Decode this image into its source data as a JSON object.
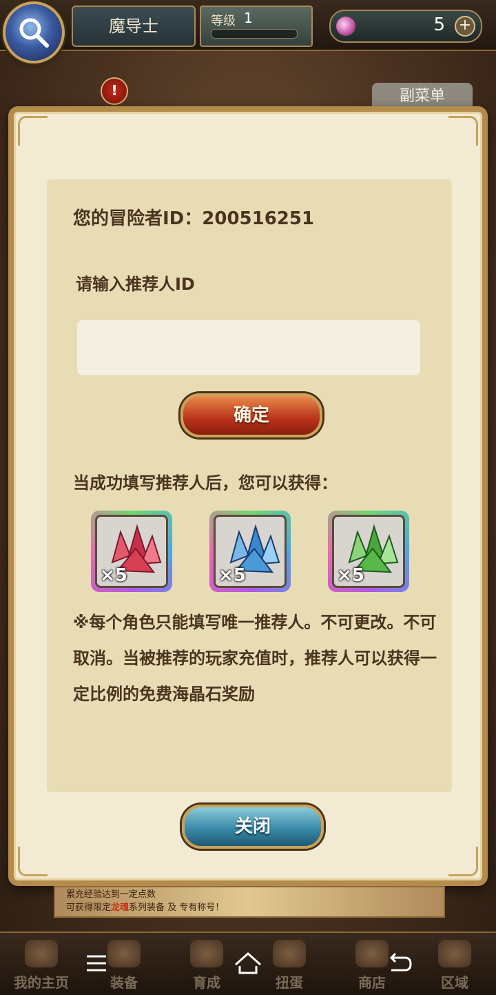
{
  "hud": {
    "player_name": "魔导士",
    "level_label": "等级",
    "level_value": "1",
    "gem_count": "5",
    "plus": "+",
    "alert": "!",
    "submenu_label": "副菜单"
  },
  "dialog": {
    "id_label": "您的冒险者ID：",
    "id_value": "200516251",
    "prompt": "请输入推荐人ID",
    "input_value": "",
    "input_placeholder": "",
    "confirm_label": "确定",
    "reward_title": "当成功填写推荐人后，您可以获得：",
    "rewards": [
      {
        "name": "red-crystal",
        "qty": "×5",
        "color": "#d83a4a"
      },
      {
        "name": "blue-crystal",
        "qty": "×5",
        "color": "#4a9ad8"
      },
      {
        "name": "green-crystal",
        "qty": "×5",
        "color": "#5ab84a"
      }
    ],
    "note": "※每个角色只能填写唯一推荐人。不可更改。不可取消。当被推荐的玩家充值时，推荐人可以获得一定比例的免费海晶石奖励",
    "close_label": "关闭"
  },
  "banner": {
    "line1": "累充经验达到一定点数",
    "line2_prefix": "可获得限定",
    "line2_highlight": "龙魂",
    "line2_suffix": "系列装备 及 专有称号！"
  },
  "nav": [
    {
      "label": "我的主页",
      "icon": "scroll-icon"
    },
    {
      "label": "装备",
      "icon": "helmet-icon"
    },
    {
      "label": "育成",
      "icon": "sword-icon"
    },
    {
      "label": "扭蛋",
      "icon": "gacha-icon"
    },
    {
      "label": "商店",
      "icon": "bag-icon"
    },
    {
      "label": "区域",
      "icon": "globe-icon"
    }
  ],
  "system_buttons": [
    "menu-icon",
    "home-icon",
    "back-icon"
  ]
}
